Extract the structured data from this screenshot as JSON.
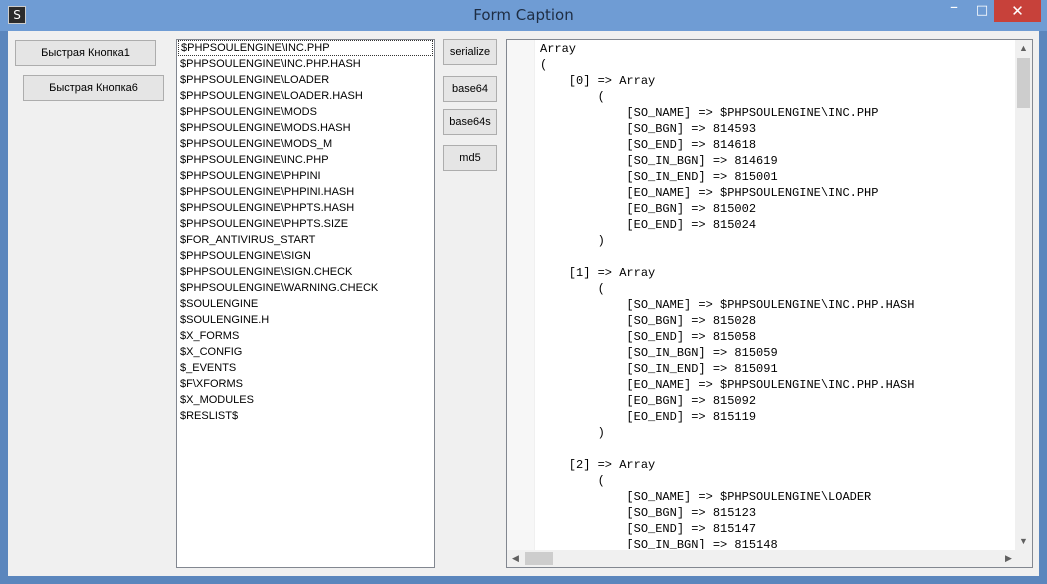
{
  "window": {
    "title": "Form Caption",
    "icon_letter": "S",
    "minimize_glyph": "–",
    "maximize_glyph": "□",
    "close_glyph": "✕"
  },
  "buttons": {
    "quick1": "Быстрая Кнопка1",
    "quick6": "Быстрая Кнопка6",
    "serialize": "serialize",
    "base64": "base64",
    "base64s": "base64s",
    "md5": "md5"
  },
  "list": {
    "selected_index": 0,
    "items": [
      "$PHPSOULENGINE\\INC.PHP",
      "$PHPSOULENGINE\\INC.PHP.HASH",
      "$PHPSOULENGINE\\LOADER",
      "$PHPSOULENGINE\\LOADER.HASH",
      "$PHPSOULENGINE\\MODS",
      "$PHPSOULENGINE\\MODS.HASH",
      "$PHPSOULENGINE\\MODS_M",
      "$PHPSOULENGINE\\INC.PHP",
      "$PHPSOULENGINE\\PHPINI",
      "$PHPSOULENGINE\\PHPINI.HASH",
      "$PHPSOULENGINE\\PHPTS.HASH",
      "$PHPSOULENGINE\\PHPTS.SIZE",
      "$FOR_ANTIVIRUS_START",
      "$PHPSOULENGINE\\SIGN",
      "$PHPSOULENGINE\\SIGN.CHECK",
      "$PHPSOULENGINE\\WARNING.CHECK",
      "$SOULENGINE",
      "$SOULENGINE.H",
      "$X_FORMS",
      "$X_CONFIG",
      "$_EVENTS",
      "$F\\XFORMS",
      "$X_MODULES",
      "$RESLIST$"
    ]
  },
  "code": {
    "lines": [
      "Array",
      "(",
      "    [0] => Array",
      "        (",
      "            [SO_NAME] => $PHPSOULENGINE\\INC.PHP",
      "            [SO_BGN] => 814593",
      "            [SO_END] => 814618",
      "            [SO_IN_BGN] => 814619",
      "            [SO_IN_END] => 815001",
      "            [EO_NAME] => $PHPSOULENGINE\\INC.PHP",
      "            [EO_BGN] => 815002",
      "            [EO_END] => 815024",
      "        )",
      "",
      "    [1] => Array",
      "        (",
      "            [SO_NAME] => $PHPSOULENGINE\\INC.PHP.HASH",
      "            [SO_BGN] => 815028",
      "            [SO_END] => 815058",
      "            [SO_IN_BGN] => 815059",
      "            [SO_IN_END] => 815091",
      "            [EO_NAME] => $PHPSOULENGINE\\INC.PHP.HASH",
      "            [EO_BGN] => 815092",
      "            [EO_END] => 815119",
      "        )",
      "",
      "    [2] => Array",
      "        (",
      "            [SO_NAME] => $PHPSOULENGINE\\LOADER",
      "            [SO_BGN] => 815123",
      "            [SO_END] => 815147",
      "            [SO_IN_BGN] => 815148"
    ]
  },
  "scrollbars": {
    "up_glyph": "▲",
    "down_glyph": "▼",
    "left_glyph": "◀",
    "right_glyph": "▶"
  }
}
